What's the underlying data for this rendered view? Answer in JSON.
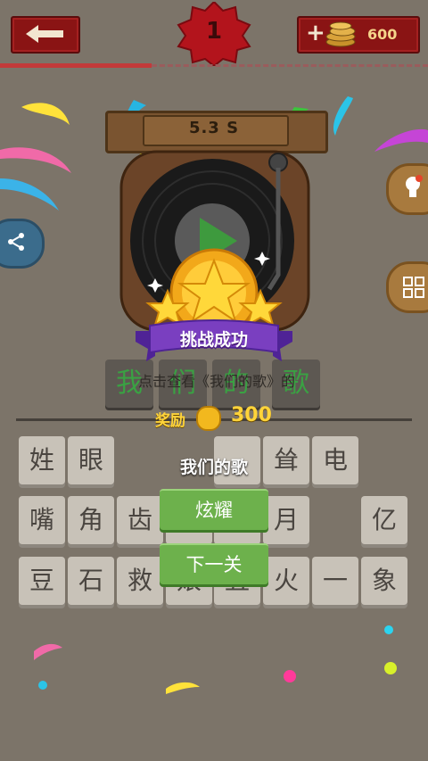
{
  "header": {
    "level": "1",
    "coin_plus": "+",
    "coins": "600"
  },
  "timer": "5.3 S",
  "answer_slots": [
    "我",
    "们",
    "的",
    "歌"
  ],
  "tiles": {
    "row1": [
      "姓",
      "眼",
      "",
      "",
      "耸",
      "电",
      ""
    ],
    "row2": [
      "嘴",
      "角",
      "齿",
      "",
      "",
      "月",
      "",
      "亿"
    ],
    "row3": [
      "豆",
      "石",
      "救",
      "娘",
      "丑",
      "火",
      "一",
      "象"
    ]
  },
  "result": {
    "title": "挑战成功",
    "hint_text": "点击查看《我们的歌》的",
    "reward_label": "奖励",
    "reward_value": "300",
    "song_name": "我们的歌",
    "show_off_button": "炫耀",
    "next_button": "下一关"
  },
  "colors": {
    "background": "#7c7469",
    "header_red": "#8a1414",
    "confirm_green": "#6db14c",
    "ribbon_purple": "#7a3fc0",
    "gold": "#ffd43a"
  },
  "icons": [
    "back-arrow-icon",
    "coin-stack-icon",
    "share-icon",
    "lightbulb-icon",
    "grid-icon",
    "play-icon",
    "star-icon",
    "coin-icon"
  ]
}
